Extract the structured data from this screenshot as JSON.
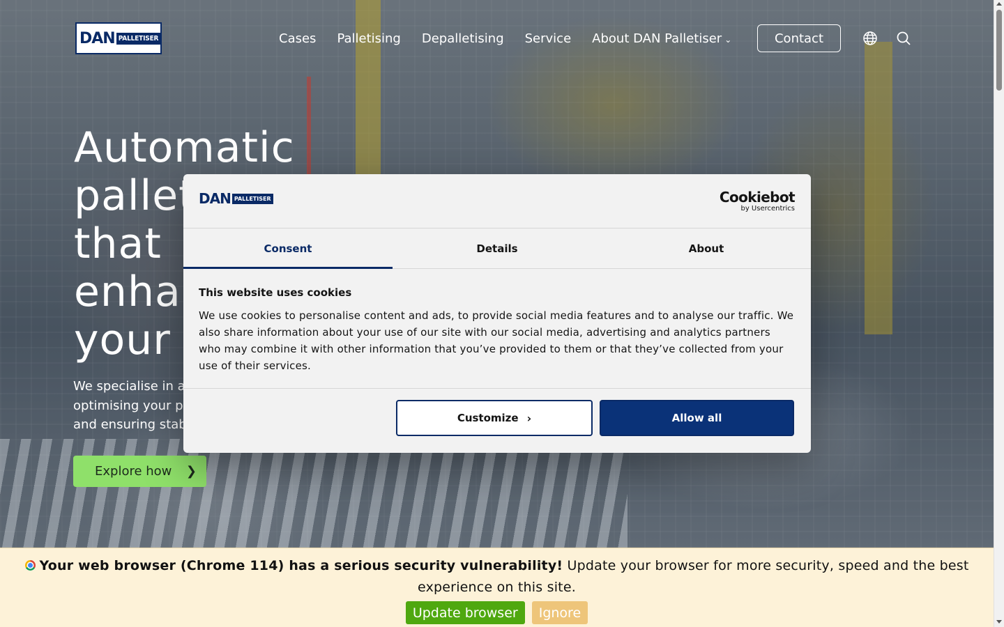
{
  "brand": {
    "logo_primary": "DAN",
    "logo_secondary": "PALLETISER",
    "navy": "#0a2a66",
    "green": "#8fe06a"
  },
  "nav": {
    "items": [
      {
        "label": "Cases"
      },
      {
        "label": "Palletising"
      },
      {
        "label": "Depalletising"
      },
      {
        "label": "Service"
      },
      {
        "label": "About DAN Palletiser"
      }
    ],
    "contact_label": "Contact",
    "icons": [
      "globe-icon",
      "search-icon"
    ]
  },
  "hero": {
    "title_lines": [
      "Automatic",
      "pallet",
      "that",
      "enhar",
      "your p"
    ],
    "subtitle_lines": [
      "We specialise in au",
      "optimising your pr",
      "and ensuring stabl"
    ],
    "cta_label": "Explore how",
    "cta_icon": "chevron-right-icon"
  },
  "cookie": {
    "logo_primary": "DAN",
    "logo_secondary": "PALLETISER",
    "provider_name": "Cookiebot",
    "provider_by": "by Usercentrics",
    "tabs": [
      {
        "label": "Consent"
      },
      {
        "label": "Details"
      },
      {
        "label": "About"
      }
    ],
    "heading": "This website uses cookies",
    "body": "We use cookies to personalise content and ads, to provide social media features and to analyse our traffic. We also share information about your use of our site with our social media, advertising and analytics partners who may combine it with other information that you’ve provided to them or that they’ve collected from your use of their services.",
    "customize_label": "Customize",
    "allow_label": "Allow all"
  },
  "update_bar": {
    "warning": "Your web browser (Chrome 114) has a serious security vulnerability!",
    "message": "Update your browser for more security, speed and the best experience on this site.",
    "update_label": "Update browser",
    "ignore_label": "Ignore"
  }
}
